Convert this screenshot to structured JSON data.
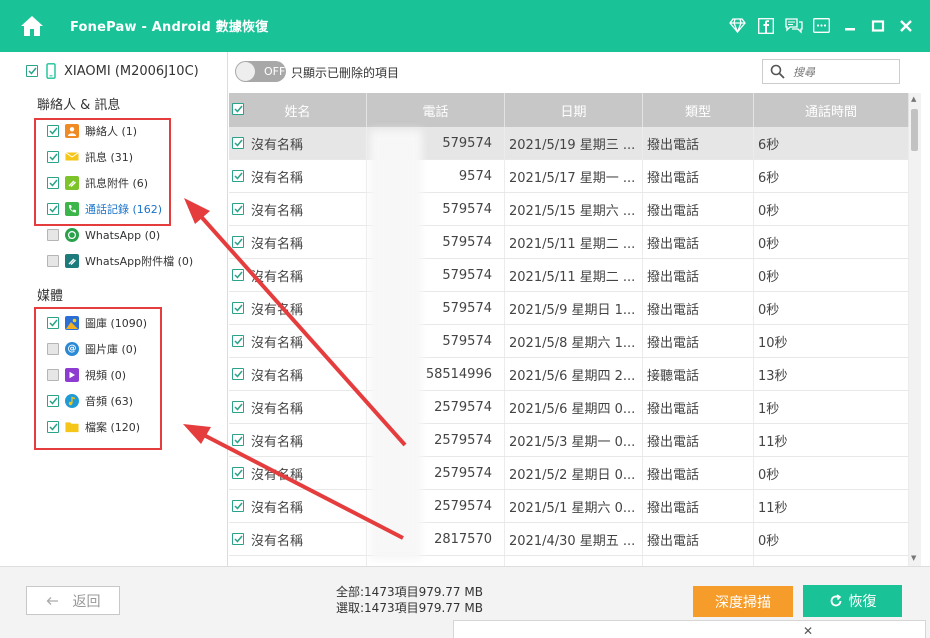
{
  "app": {
    "title": "FonePaw - Android 數據恢復"
  },
  "window_controls": [
    "diamond-icon",
    "facebook-icon",
    "feedback-icon",
    "menu-icon",
    "minimize-icon",
    "maximize-icon",
    "close-icon"
  ],
  "device": {
    "name": "XIAOMI (M2006J10C)"
  },
  "sidebar": {
    "section_contacts": "聯絡人 & 訊息",
    "contacts_items": [
      {
        "label": "聯絡人 (1)",
        "checked": true,
        "icon": "contacts-icon",
        "color": "#f08a24"
      },
      {
        "label": "訊息 (31)",
        "checked": true,
        "icon": "message-icon",
        "color": "#f5c518"
      },
      {
        "label": "訊息附件 (6)",
        "checked": true,
        "icon": "attachment-icon",
        "color": "#7dc42a"
      },
      {
        "label": "通話記錄 (162)",
        "checked": true,
        "icon": "phone-icon",
        "color": "#3cb54a",
        "active": true
      },
      {
        "label": "WhatsApp (0)",
        "checked": false,
        "icon": "whatsapp-icon",
        "color": "#2aa14b"
      },
      {
        "label": "WhatsApp附件檔 (0)",
        "checked": false,
        "icon": "whatsapp-attachment-icon",
        "color": "#1e7b7b"
      }
    ],
    "section_media": "媒體",
    "media_items": [
      {
        "label": "圖庫 (1090)",
        "checked": true,
        "icon": "gallery-icon",
        "color": "#f2b01e"
      },
      {
        "label": "圖片庫 (0)",
        "checked": false,
        "icon": "picture-library-icon",
        "color": "#2b8ad6"
      },
      {
        "label": "視頻 (0)",
        "checked": false,
        "icon": "video-icon",
        "color": "#8e3bd1"
      },
      {
        "label": "音頻 (63)",
        "checked": true,
        "icon": "audio-icon",
        "color": "#1e9bd7"
      },
      {
        "label": "檔案 (120)",
        "checked": true,
        "icon": "folder-icon",
        "color": "#f5c518"
      }
    ]
  },
  "toolbar": {
    "toggle_text": "OFF",
    "toggle_label": "只顯示已刪除的項目",
    "search_placeholder": "搜尋"
  },
  "table": {
    "headers": [
      "姓名",
      "電話",
      "日期",
      "類型",
      "通話時間"
    ],
    "rows": [
      {
        "name": "沒有名稱",
        "phone": "579574",
        "date": "2021/5/19 星期三 ...",
        "type": "撥出電話",
        "duration": "6秒",
        "selected": true
      },
      {
        "name": "沒有名稱",
        "phone": "9574",
        "date": "2021/5/17 星期一 ...",
        "type": "撥出電話",
        "duration": "6秒"
      },
      {
        "name": "沒有名稱",
        "phone": "579574",
        "date": "2021/5/15 星期六 ...",
        "type": "撥出電話",
        "duration": "0秒"
      },
      {
        "name": "沒有名稱",
        "phone": "579574",
        "date": "2021/5/11 星期二 ...",
        "type": "撥出電話",
        "duration": "0秒"
      },
      {
        "name": "沒有名稱",
        "phone": "579574",
        "date": "2021/5/11 星期二 ...",
        "type": "撥出電話",
        "duration": "0秒"
      },
      {
        "name": "沒有名稱",
        "phone": "579574",
        "date": "2021/5/9 星期日 1...",
        "type": "撥出電話",
        "duration": "0秒"
      },
      {
        "name": "沒有名稱",
        "phone": "579574",
        "date": "2021/5/8 星期六 1...",
        "type": "撥出電話",
        "duration": "10秒"
      },
      {
        "name": "沒有名稱",
        "phone": "58514996",
        "date": "2021/5/6 星期四 2...",
        "type": "接聽電話",
        "duration": "13秒"
      },
      {
        "name": "沒有名稱",
        "phone": "2579574",
        "date": "2021/5/6 星期四 0...",
        "type": "撥出電話",
        "duration": "1秒"
      },
      {
        "name": "沒有名稱",
        "phone": "2579574",
        "date": "2021/5/3 星期一 0...",
        "type": "撥出電話",
        "duration": "11秒"
      },
      {
        "name": "沒有名稱",
        "phone": "2579574",
        "date": "2021/5/2 星期日 0...",
        "type": "撥出電話",
        "duration": "0秒"
      },
      {
        "name": "沒有名稱",
        "phone": "2579574",
        "date": "2021/5/1 星期六 0...",
        "type": "撥出電話",
        "duration": "11秒"
      },
      {
        "name": "沒有名稱",
        "phone": "2817570",
        "date": "2021/4/30 星期五 ...",
        "type": "撥出電話",
        "duration": "0秒"
      },
      {
        "name": "",
        "phone": "",
        "date": "",
        "type": "",
        "duration": ""
      }
    ]
  },
  "footer": {
    "back_label": "返回",
    "total_text": "全部:1473項目979.77 MB",
    "selected_text": "選取:1473項目979.77 MB",
    "deep_scan_label": "深度掃描",
    "recover_label": "恢復"
  },
  "colors": {
    "brand": "#19c297",
    "deep_scan": "#f59c2b",
    "annotation": "#e53d3d",
    "header": "#c7c7c7"
  }
}
